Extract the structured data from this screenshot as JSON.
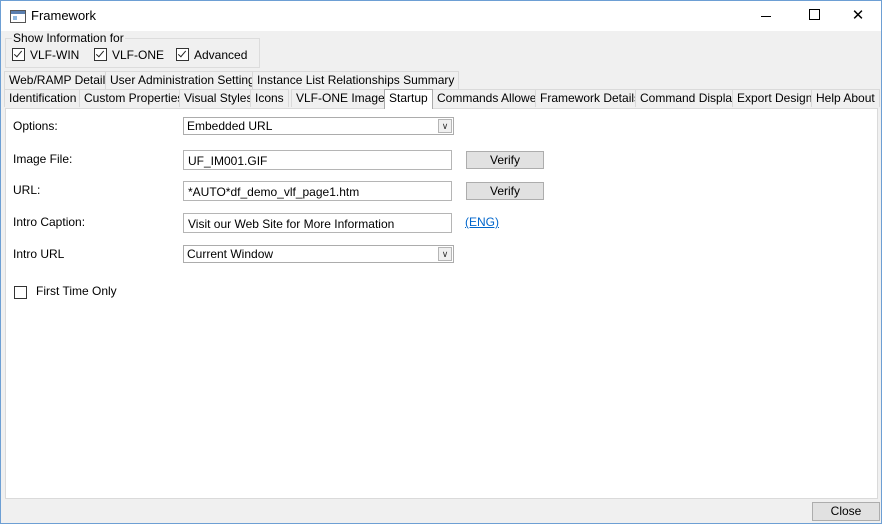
{
  "window": {
    "title": "Framework"
  },
  "show_info": {
    "legend": "Show Information for",
    "options": [
      {
        "label": "VLF-WIN",
        "checked": true
      },
      {
        "label": "VLF-ONE",
        "checked": true
      },
      {
        "label": "Advanced",
        "checked": true
      }
    ]
  },
  "tabs_row1": [
    "Web/RAMP Details",
    "User Administration Settings",
    "Instance List Relationships Summary"
  ],
  "tabs_row2": [
    "Identification",
    "Custom Properties",
    "Visual Styles",
    "Icons",
    "VLF-ONE Images",
    "Startup",
    "Commands Allowed",
    "Framework Details",
    "Command Display",
    "Export Design",
    "Help About"
  ],
  "active_tab": "Startup",
  "startup": {
    "options_label": "Options:",
    "options_value": "Embedded URL",
    "image_file_label": "Image File:",
    "image_file_value": "UF_IM001.GIF",
    "url_label": "URL:",
    "url_value": "*AUTO*df_demo_vlf_page1.htm",
    "intro_caption_label": "Intro Caption:",
    "intro_caption_value": "Visit our Web Site for More Information",
    "lang_link": "(ENG)",
    "intro_url_label": "Intro URL",
    "intro_url_value": "Current Window",
    "verify_label": "Verify",
    "first_time_label": "First Time Only",
    "first_time_checked": false
  },
  "footer": {
    "close_label": "Close"
  }
}
